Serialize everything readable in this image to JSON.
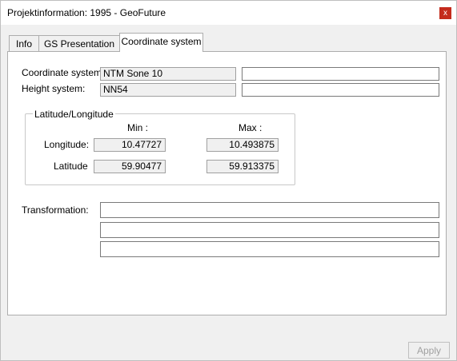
{
  "window": {
    "title": "Projektinformation: 1995 - GeoFuture",
    "close_label": "x"
  },
  "tabs": [
    {
      "label": "Info"
    },
    {
      "label": "GS Presentation"
    },
    {
      "label": "Coordinate system",
      "active": true
    }
  ],
  "coordinate_system": {
    "label": "Coordinate system:",
    "value": "NTM Sone 10",
    "extra_value": ""
  },
  "height_system": {
    "label": "Height system:",
    "value": "NN54",
    "extra_value": ""
  },
  "latlon": {
    "group_label": "Latitude/Longitude",
    "min_header": "Min :",
    "max_header": "Max :",
    "longitude_label": "Longitude:",
    "latitude_label": "Latitude",
    "longitude_min": "10.47727",
    "longitude_max": "10.493875",
    "latitude_min": "59.90477",
    "latitude_max": "59.913375"
  },
  "transformation": {
    "label": "Transformation:",
    "lines": [
      "",
      "",
      ""
    ]
  },
  "buttons": {
    "apply": "Apply"
  },
  "colors": {
    "close_button": "#c42b1c",
    "panel_bg": "#ffffff",
    "window_bg": "#f0f0f0"
  }
}
